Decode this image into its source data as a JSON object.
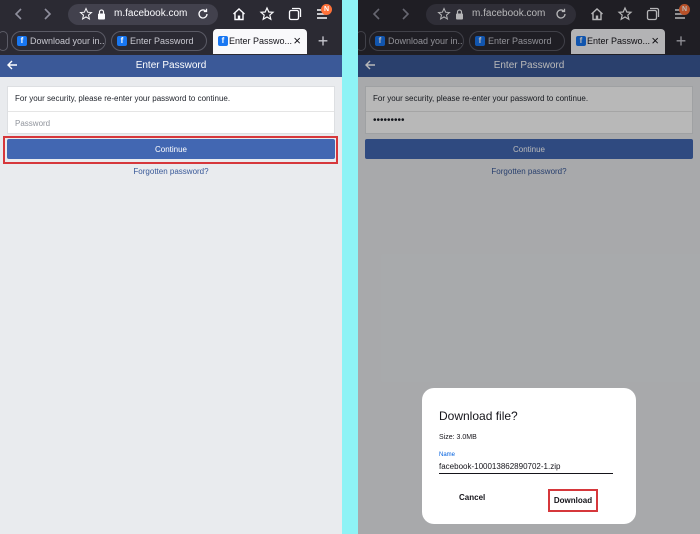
{
  "browser": {
    "url": "m.facebook.com",
    "profile_badge": "N",
    "tabs": [
      {
        "label": "Download your in..."
      },
      {
        "label": "Enter Password"
      },
      {
        "label": "Enter Passwo..."
      }
    ],
    "tab_favicon": "f",
    "close_glyph": "×",
    "new_tab_glyph": "+"
  },
  "page": {
    "title": "Enter Password",
    "security_message": "For your security, please re-enter your password to continue.",
    "password_placeholder": "Password",
    "password_value_masked": "•••••••••",
    "continue_label": "Continue",
    "forgot_label": "Forgotten password?"
  },
  "download_dialog": {
    "title": "Download file?",
    "size": "Size: 3.0MB",
    "name_label": "Name",
    "file_name": "facebook-100013862890702-1.zip",
    "cancel_label": "Cancel",
    "download_label": "Download"
  },
  "colors": {
    "chrome_bg": "#2b2a33",
    "fb_blue": "#3b5998",
    "button_blue": "#4267b2",
    "highlight_red": "#d6373b",
    "divider_cyan": "#8ef3f5"
  }
}
